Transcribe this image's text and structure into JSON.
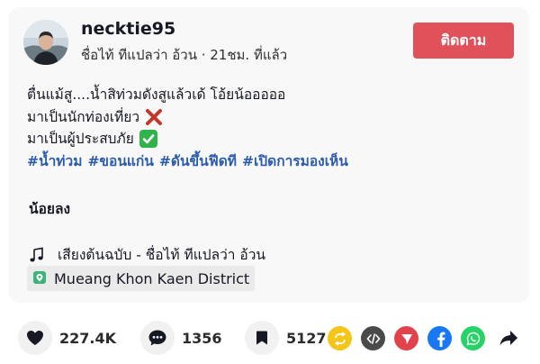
{
  "post": {
    "username": "necktie95",
    "subline": "ชื่อไท้ ทีแปลว่า อ้วน · 21ชม. ที่แล้ว",
    "follow_label": "ติดตาม",
    "caption_lines": [
      "ตื่นแม้สู....น้ำสิท่วมดังสูแล้วเด้ โอ้ยน้อออออ",
      "มาเป็นนักท่องเที่ยว",
      "มาเป็นผู้ประสบภัย"
    ],
    "hashtags": [
      "#น้ำท่วม",
      "#ขอนแก่น",
      "#ดันขึ้นฟีดที",
      "#เปิดการมองเห็น"
    ],
    "more_label": "น้อยลง",
    "music": "เสียงต้นฉบับ - ชื่อไท้ ทีแปลว่า อ้วน",
    "location": "Mueang Khon Kaen District"
  },
  "actions": {
    "likes": "227.4K",
    "comments": "1356",
    "saves": "5127"
  },
  "share_targets": [
    {
      "icon": "repost-icon",
      "color": "#f5c518"
    },
    {
      "icon": "embed-icon",
      "color": "#4a4a4a"
    },
    {
      "icon": "send-icon",
      "color": "#e2424b"
    },
    {
      "icon": "facebook-icon",
      "color": "#1877f2"
    },
    {
      "icon": "whatsapp-icon",
      "color": "#25d366"
    },
    {
      "icon": "share-arrow-icon",
      "color": "#161823"
    }
  ]
}
